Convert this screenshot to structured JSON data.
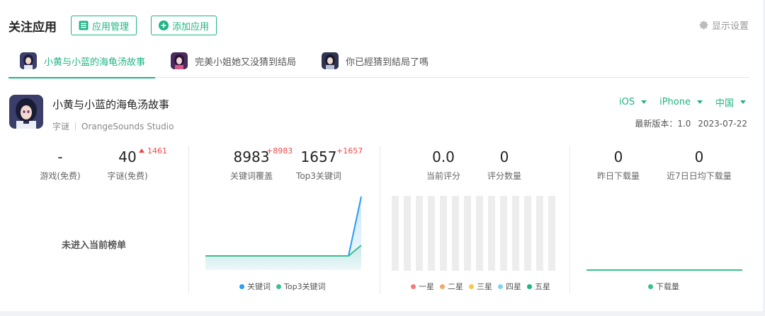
{
  "header": {
    "title": "关注应用",
    "manage_label": "应用管理",
    "add_label": "添加应用",
    "settings_label": "显示设置",
    "accent": "#1db584"
  },
  "tabs": [
    {
      "label": "小黄与小蓝的海龟汤故事",
      "active": true
    },
    {
      "label": "完美小姐她又没猜到结局",
      "active": false
    },
    {
      "label": "你已經猜到結局了嗎",
      "active": false
    }
  ],
  "app": {
    "name": "小黄与小蓝的海龟汤故事",
    "category": "字谜",
    "developer": "OrangeSounds Studio",
    "platform": "iOS",
    "device": "iPhone",
    "region": "中国",
    "version_label": "最新版本：1.0",
    "date": "2023-07-22"
  },
  "rank": {
    "free_games_value": "-",
    "free_games_label": "游戏(免费)",
    "puzzle_value": "40",
    "puzzle_label": "字谜(免费)",
    "puzzle_delta": "1461",
    "empty_text": "未进入当前榜单"
  },
  "keywords": {
    "coverage_value": "8983",
    "coverage_delta": "+8983",
    "coverage_label": "关键词覆盖",
    "top3_value": "1657",
    "top3_delta": "+1657",
    "top3_label": "Top3关键词",
    "legend": [
      "关键词",
      "Top3关键词"
    ]
  },
  "rating": {
    "score_value": "0.0",
    "score_label": "当前评分",
    "count_value": "0",
    "count_label": "评分数量",
    "legend": [
      "一星",
      "二星",
      "三星",
      "四星",
      "五星"
    ]
  },
  "downloads": {
    "yesterday_value": "0",
    "yesterday_label": "昨日下载量",
    "avg7_value": "0",
    "avg7_label": "近7日日均下载量",
    "legend": [
      "下载量"
    ]
  },
  "colors": {
    "keyword": "#2a9df4",
    "top3": "#3cbf8c",
    "star1": "#f47a7a",
    "star2": "#f4a86a",
    "star3": "#f4c84a",
    "star4": "#7fd3f0",
    "star5": "#1db584"
  }
}
